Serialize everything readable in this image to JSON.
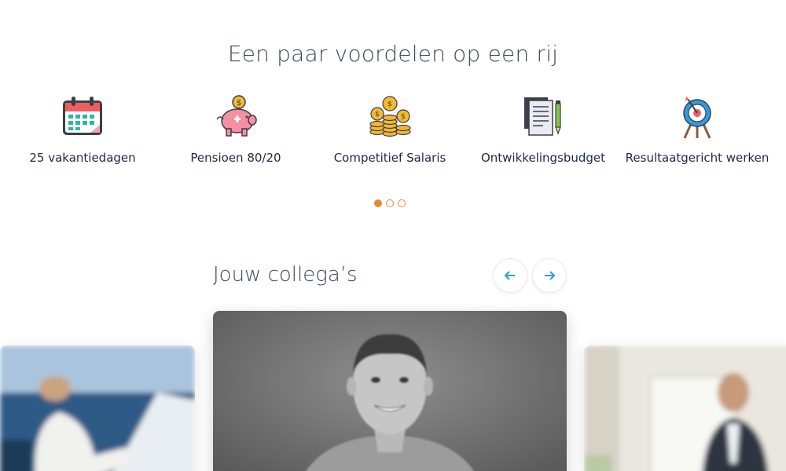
{
  "benefits_section": {
    "title": "Een paar voordelen op een rij",
    "items": [
      {
        "label": "25 vakantiedagen",
        "icon": "calendar-icon"
      },
      {
        "label": "Pensioen 80/20",
        "icon": "piggy-bank-icon"
      },
      {
        "label": "Competitief Salaris",
        "icon": "coins-icon"
      },
      {
        "label": "Ontwikkelingsbudget",
        "icon": "documents-pencil-icon"
      },
      {
        "label": "Resultaatgericht werken",
        "icon": "target-icon"
      }
    ],
    "pagination": {
      "count": 3,
      "active": 1
    }
  },
  "colleagues_section": {
    "title": "Jouw collega’s",
    "prev_icon": "arrow-left-icon",
    "next_icon": "arrow-right-icon"
  },
  "colors": {
    "accent": "#e58a3c",
    "arrow": "#2f9be0",
    "text": "#1f2a44"
  }
}
